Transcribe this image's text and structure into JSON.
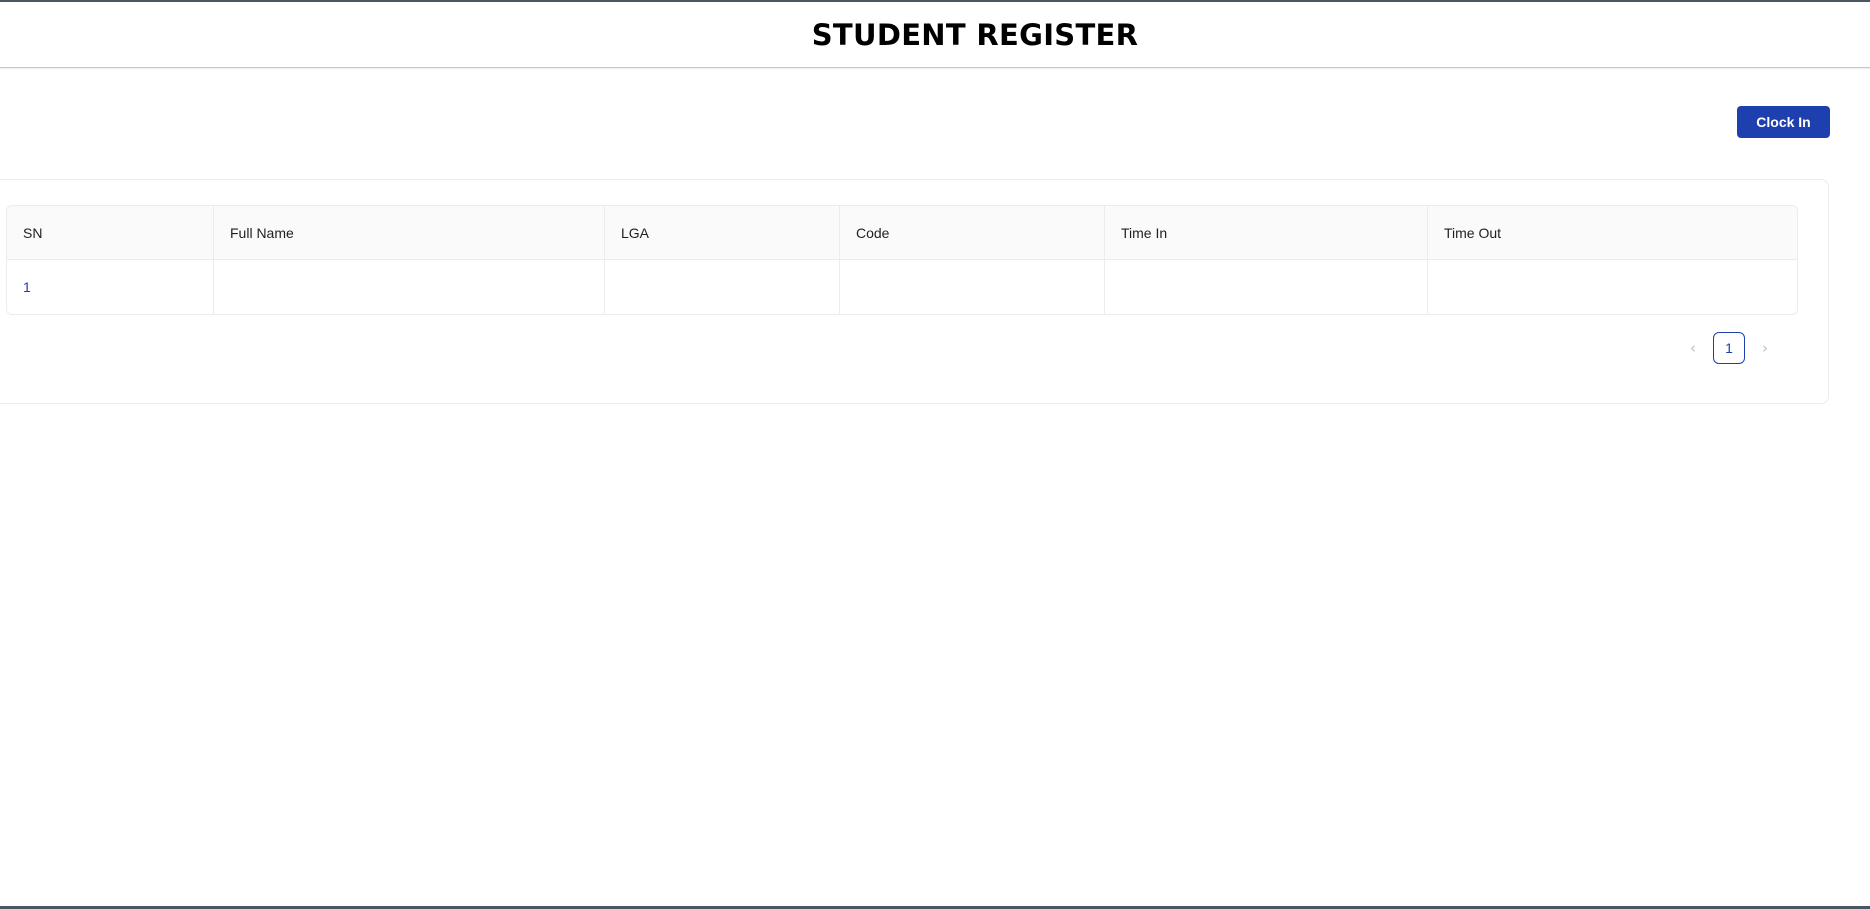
{
  "header": {
    "title": "STUDENT REGISTER"
  },
  "actions": {
    "clock_in_label": "Clock In"
  },
  "table": {
    "columns": [
      "SN",
      "Full Name",
      "LGA",
      "Code",
      "Time In",
      "Time Out"
    ],
    "rows": [
      [
        "1",
        "",
        "",
        "",
        "",
        ""
      ]
    ]
  },
  "pagination": {
    "current_page": "1",
    "prev_icon": "chevron-left-icon",
    "next_icon": "chevron-right-icon"
  },
  "colors": {
    "accent": "#1e40af",
    "header_bg": "#fafafa",
    "border": "#ececec"
  }
}
